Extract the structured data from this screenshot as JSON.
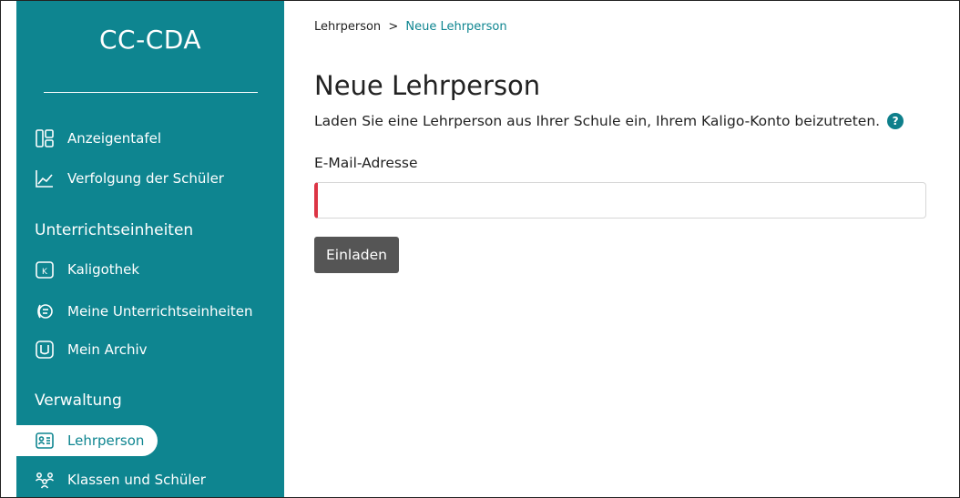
{
  "sidebar": {
    "brand": "CC-CDA",
    "items": [
      {
        "label": "Anzeigentafel",
        "icon": "dashboard-icon"
      },
      {
        "label": "Verfolgung der Schüler",
        "icon": "chart-line-icon"
      }
    ],
    "section_units": "Unterrichtseinheiten",
    "unit_items": [
      {
        "label": "Kaligothek",
        "icon": "kaligothek-icon"
      },
      {
        "label": "Meine Unterrichtseinheiten",
        "icon": "lessons-icon"
      },
      {
        "label": "Mein Archiv",
        "icon": "archive-icon"
      }
    ],
    "section_admin": "Verwaltung",
    "admin_items": [
      {
        "label": "Lehrperson",
        "icon": "teacher-card-icon",
        "active": true
      },
      {
        "label": "Klassen und Schüler",
        "icon": "people-icon"
      }
    ]
  },
  "breadcrumb": {
    "parent": "Lehrperson",
    "separator": ">",
    "current": "Neue Lehrperson"
  },
  "main": {
    "title": "Neue Lehrperson",
    "subtitle": "Laden Sie eine Lehrperson aus Ihrer Schule ein, Ihrem Kaligo-Konto beizutreten.",
    "help_glyph": "?",
    "email_label": "E-Mail-Adresse",
    "email_value": "",
    "invite_label": "Einladen"
  },
  "colors": {
    "sidebar_bg": "#0e8590",
    "accent": "#0e8590",
    "error_border": "#dc3545",
    "button_bg": "#555555"
  }
}
